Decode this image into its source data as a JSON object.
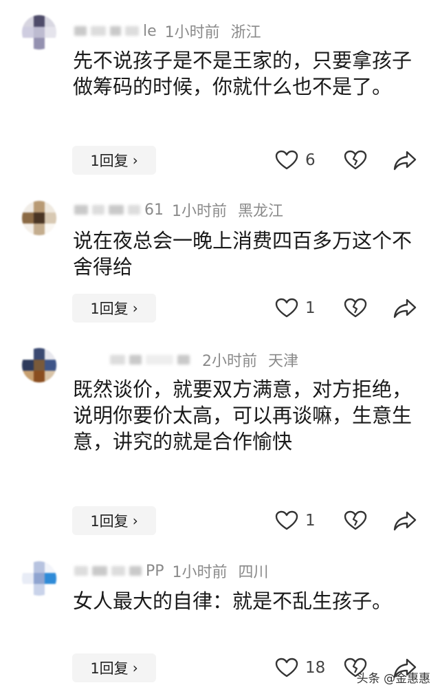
{
  "comments": [
    {
      "name_tail": "le",
      "time": "1小时前",
      "location": "浙江",
      "text": "先不说孩子是不是王家的，只要拿孩子做筹码的时候，你就什么也不是了。",
      "reply_label": "1回复",
      "likes": "6"
    },
    {
      "name_tail": "61",
      "time": "1小时前",
      "location": "黑龙江",
      "text": "说在夜总会一晚上消费四百多万这个不舍得给",
      "reply_label": "1回复",
      "likes": "1"
    },
    {
      "name_tail": "",
      "time": "2小时前",
      "location": "天津",
      "text": "既然谈价，就要双方满意，对方拒绝，说明你要价太高，可以再谈嘛，生意生意，讲究的就是合作愉快",
      "reply_label": "1回复",
      "likes": "1"
    },
    {
      "name_tail": "PP",
      "time": "1小时前",
      "location": "四川",
      "text": "女人最大的自律：就是不乱生孩子。",
      "reply_label": "1回复",
      "likes": "18"
    }
  ],
  "watermark": "头条 @金惠惠",
  "icons": {
    "like": "heart-outline-icon",
    "dislike": "broken-heart-icon",
    "share": "share-arrow-icon",
    "reply": "chevron-right-icon"
  },
  "colors": {
    "text": "#1a1a1a",
    "meta": "#8a8a8a",
    "reply_bg": "#f4f4f4",
    "icon": "#333333"
  }
}
